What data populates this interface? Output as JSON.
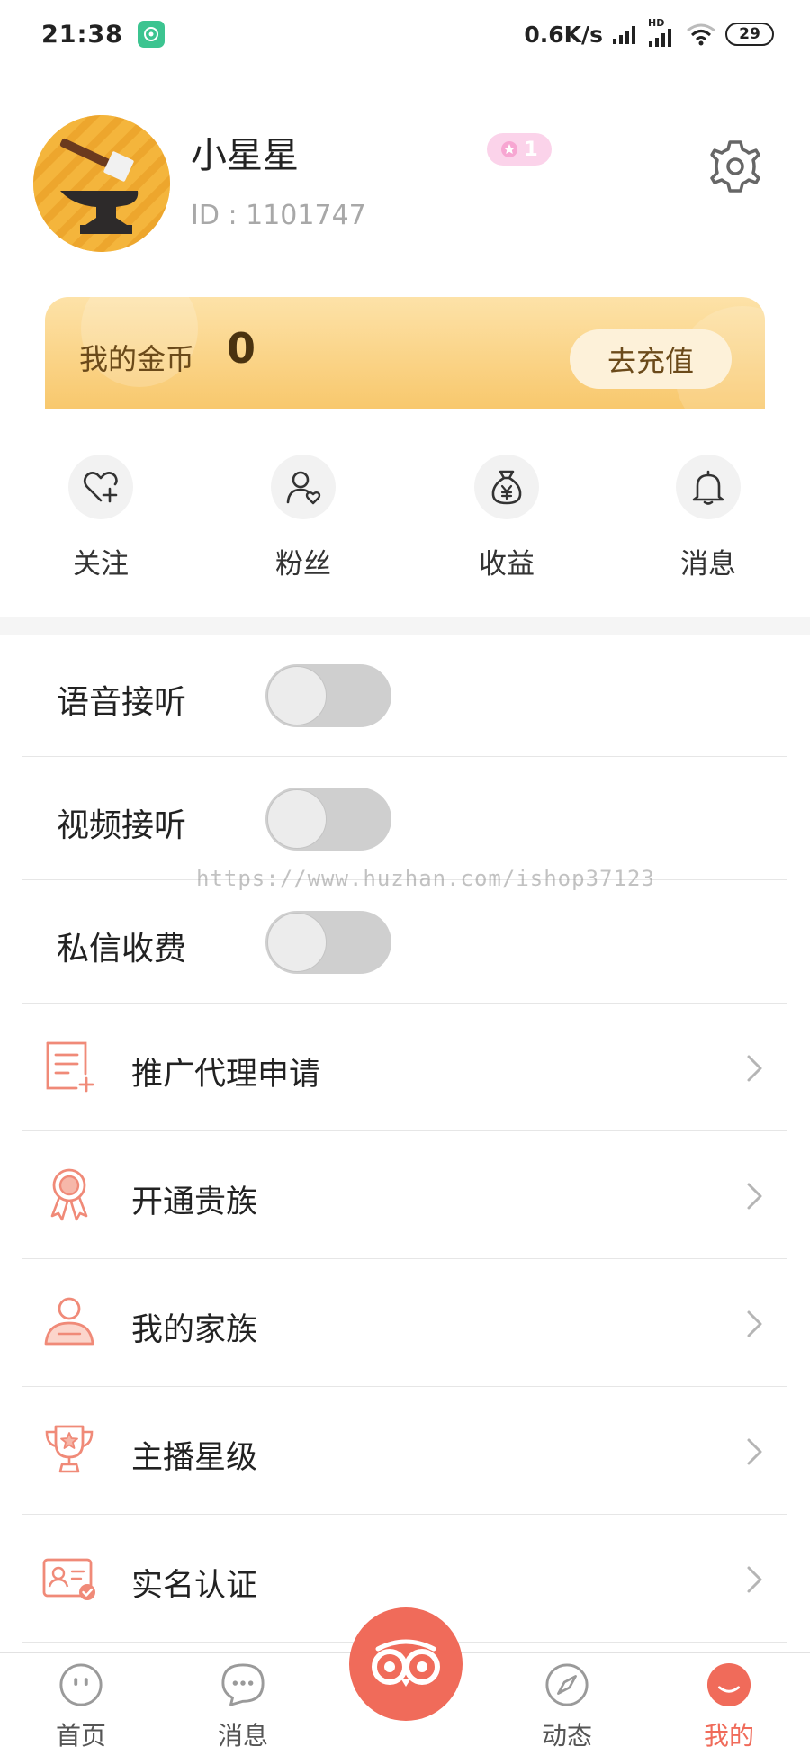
{
  "status_bar": {
    "time": "21:38",
    "network_speed": "0.6K/s",
    "battery": "29",
    "hd_label": "HD"
  },
  "profile": {
    "name": "小星星",
    "id_text": "ID : 1101747",
    "level": "1"
  },
  "coins": {
    "label": "我的金币",
    "value": "0",
    "recharge_label": "去充值"
  },
  "quick_actions": [
    {
      "label": "关注",
      "icon": "heart-plus-icon"
    },
    {
      "label": "粉丝",
      "icon": "user-heart-icon"
    },
    {
      "label": "收益",
      "icon": "money-bag-icon"
    },
    {
      "label": "消息",
      "icon": "bell-icon"
    }
  ],
  "toggles": [
    {
      "label": "语音接听",
      "on": false
    },
    {
      "label": "视频接听",
      "on": false
    },
    {
      "label": "私信收费",
      "on": false
    }
  ],
  "menu": [
    {
      "label": "推广代理申请",
      "icon": "document-plus-icon"
    },
    {
      "label": "开通贵族",
      "icon": "medal-icon"
    },
    {
      "label": "我的家族",
      "icon": "family-user-icon"
    },
    {
      "label": "主播星级",
      "icon": "trophy-star-icon"
    },
    {
      "label": "实名认证",
      "icon": "id-card-check-icon"
    }
  ],
  "watermark": "https://www.huzhan.com/ishop37123",
  "bottom_nav": [
    {
      "label": "首页",
      "icon": "home-face-icon",
      "active": false
    },
    {
      "label": "消息",
      "icon": "chat-bubble-icon",
      "active": false
    },
    {
      "label": "动态",
      "icon": "compass-icon",
      "active": false
    },
    {
      "label": "我的",
      "icon": "profile-face-icon",
      "active": true
    }
  ],
  "colors": {
    "accent": "#f06b5a",
    "coin_card_top": "#fde2a8",
    "coin_card_bottom": "#f8c86d",
    "level_badge": "#fbd3ea",
    "menu_icon": "#f08a78"
  }
}
